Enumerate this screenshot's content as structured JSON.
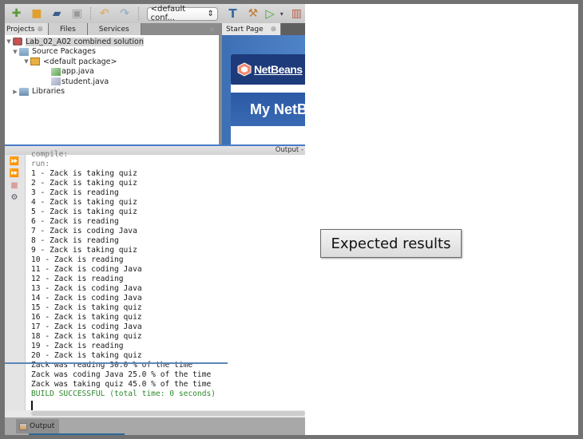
{
  "toolbar": {
    "buttons": [
      {
        "name": "new-file-button",
        "icon": "new-file-icon",
        "glyph": "📄"
      },
      {
        "name": "new-project-button",
        "icon": "new-project-icon",
        "glyph": "📁"
      },
      {
        "name": "open-project-button",
        "icon": "open-project-icon",
        "glyph": "📂"
      },
      {
        "name": "save-all-button",
        "icon": "save-all-icon",
        "glyph": "▣"
      },
      {
        "name": "undo-button",
        "icon": "undo-icon",
        "glyph": "↶"
      },
      {
        "name": "redo-button",
        "icon": "redo-icon",
        "glyph": "↷"
      }
    ],
    "config_select": {
      "value": "<default conf...",
      "arrow": "⇕"
    },
    "buttons_right": [
      {
        "name": "build-button",
        "icon": "hammer-icon",
        "glyph": "T"
      },
      {
        "name": "clean-build-button",
        "icon": "clean-build-icon",
        "glyph": "⚒"
      },
      {
        "name": "run-button",
        "icon": "run-icon",
        "glyph": "▷"
      },
      {
        "name": "run-dropdown",
        "icon": "chevron-down-icon",
        "glyph": "▾"
      },
      {
        "name": "debug-button",
        "icon": "debug-icon",
        "glyph": "▥"
      }
    ]
  },
  "projects_panel": {
    "tabs": [
      {
        "label": "Projects",
        "active": true,
        "closable": true
      },
      {
        "label": "Files",
        "active": false,
        "closable": false
      },
      {
        "label": "Services",
        "active": false,
        "closable": false
      }
    ],
    "minimize_glyph": "▫",
    "tree": [
      {
        "label": "Lab_02_A02 combined solution",
        "level": 0,
        "expanded": true,
        "icon": "project-icon",
        "selected": true
      },
      {
        "label": "Source Packages",
        "level": 1,
        "expanded": true,
        "icon": "folder-icon"
      },
      {
        "label": "<default package>",
        "level": 2,
        "expanded": true,
        "icon": "package-icon"
      },
      {
        "label": "app.java",
        "level": 3,
        "icon": "java-main-file-icon"
      },
      {
        "label": "student.java",
        "level": 3,
        "icon": "java-file-icon"
      },
      {
        "label": "Libraries",
        "level": 1,
        "expanded": false,
        "icon": "libraries-icon"
      }
    ]
  },
  "editor": {
    "tab_label": "Start Page",
    "brand": "NetBeans",
    "heading": "My NetB"
  },
  "output": {
    "header_label": "Output -",
    "lines": [
      {
        "text": "compile:",
        "style": "gray"
      },
      {
        "text": "run:",
        "style": "gray"
      },
      {
        "text": "1 - Zack is taking quiz"
      },
      {
        "text": "2 - Zack is taking quiz"
      },
      {
        "text": "3 - Zack is reading"
      },
      {
        "text": "4 - Zack is taking quiz"
      },
      {
        "text": "5 - Zack is taking quiz"
      },
      {
        "text": "6 - Zack is reading"
      },
      {
        "text": "7 - Zack is coding Java"
      },
      {
        "text": "8 - Zack is reading"
      },
      {
        "text": "9 - Zack is taking quiz"
      },
      {
        "text": "10 - Zack is reading"
      },
      {
        "text": "11 - Zack is coding Java"
      },
      {
        "text": "12 - Zack is reading"
      },
      {
        "text": "13 - Zack is coding Java"
      },
      {
        "text": "14 - Zack is coding Java"
      },
      {
        "text": "15 - Zack is taking quiz"
      },
      {
        "text": "16 - Zack is taking quiz"
      },
      {
        "text": "17 - Zack is coding Java"
      },
      {
        "text": "18 - Zack is taking quiz"
      },
      {
        "text": "19 - Zack is reading"
      },
      {
        "text": "20 - Zack is taking quiz"
      },
      {
        "text": "Zack was reading 30.0 % of the time"
      },
      {
        "text": "Zack was coding Java 25.0 % of the time"
      },
      {
        "text": "Zack was taking quiz 45.0 % of the time"
      },
      {
        "text": "BUILD SUCCESSFUL (total time: 0 seconds)",
        "style": "green"
      }
    ],
    "gutter_buttons": [
      {
        "name": "rerun-button",
        "icon": "rerun-icon",
        "glyph": "⏩",
        "color": "#3aa53a"
      },
      {
        "name": "rerun-with-params-button",
        "icon": "rerun-params-icon",
        "glyph": "⏩",
        "color": "#c8b020"
      },
      {
        "name": "stop-button",
        "icon": "stop-icon",
        "glyph": "■",
        "color": "#d9a0a0"
      },
      {
        "name": "settings-button",
        "icon": "settings-icon",
        "glyph": "⚙",
        "color": "#556"
      }
    ],
    "bottom_tab": "Output"
  },
  "annotation": {
    "label": "Expected results"
  }
}
